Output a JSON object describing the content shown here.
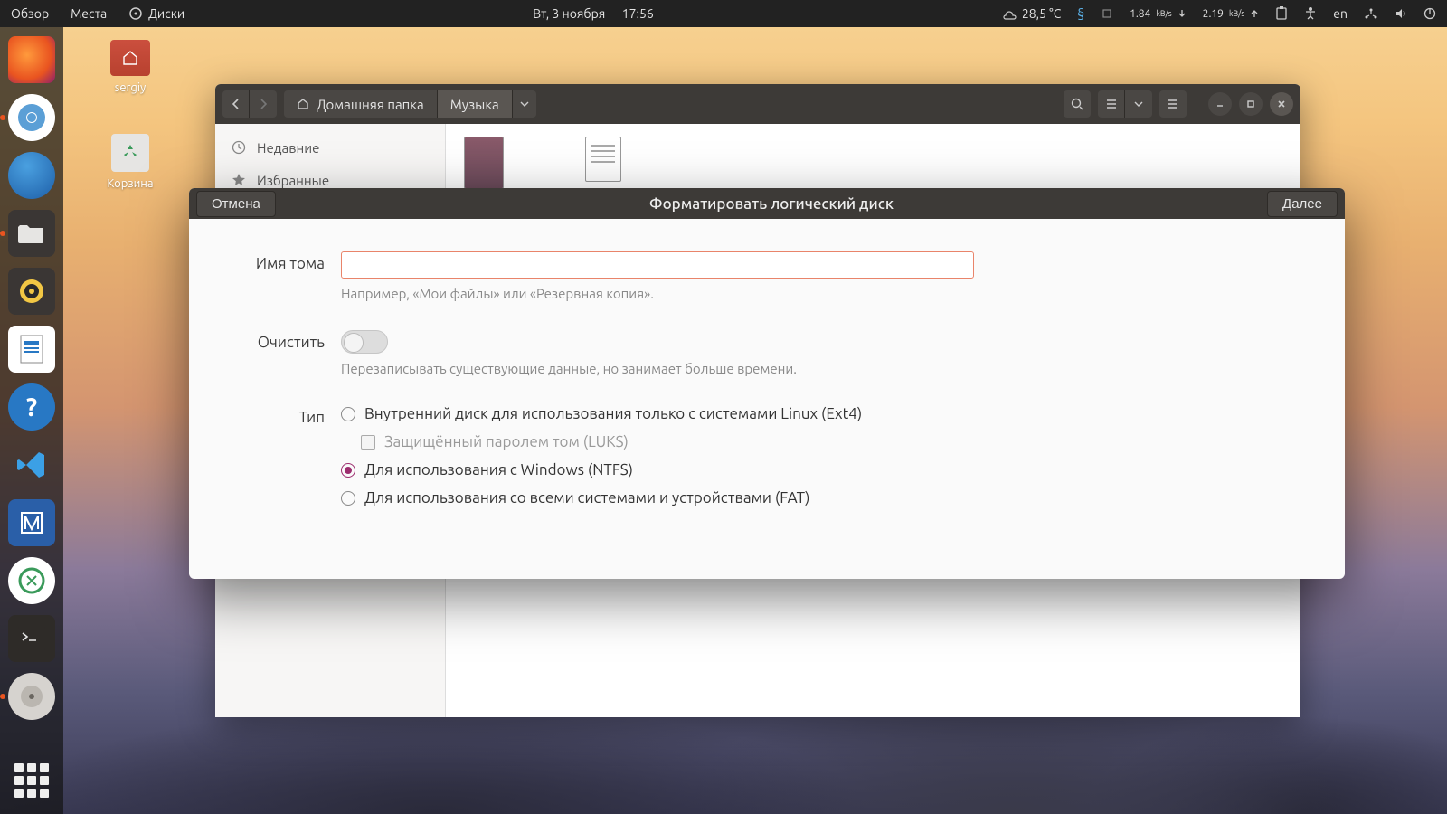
{
  "topbar": {
    "left": [
      "Обзор",
      "Места"
    ],
    "app_indicator": "Диски",
    "date": "Вт, 3 ноября",
    "time": "17:56",
    "temp": "28,5 °C",
    "net_down": "1.84",
    "net_down_unit": "kB/s",
    "net_up": "2.19",
    "net_up_unit": "kB/s",
    "lang": "en"
  },
  "desktop": {
    "home_label": "sergiy",
    "trash_label": "Корзина"
  },
  "files_window": {
    "path": [
      "Домашняя папка",
      "Музыка"
    ],
    "sidebar": [
      {
        "icon": "clock",
        "label": "Недавние"
      },
      {
        "icon": "star",
        "label": "Избранные"
      }
    ]
  },
  "dialog": {
    "cancel": "Отмена",
    "title": "Форматировать логический диск",
    "next": "Далее",
    "volume_label": "Имя тома",
    "volume_value": "",
    "volume_helper": "Например, «Мои файлы» или «Резервная копия».",
    "erase_label": "Очистить",
    "erase_on": false,
    "erase_helper": "Перезаписывать существующие данные, но занимает больше времени.",
    "type_label": "Тип",
    "options": {
      "ext4": "Внутренний диск для использования только с системами Linux (Ext4)",
      "luks": "Защищённый паролем том (LUKS)",
      "ntfs": "Для использования с Windows (NTFS)",
      "fat": "Для использования со всеми системами и устройствами (FAT)"
    },
    "selected": "ntfs"
  }
}
